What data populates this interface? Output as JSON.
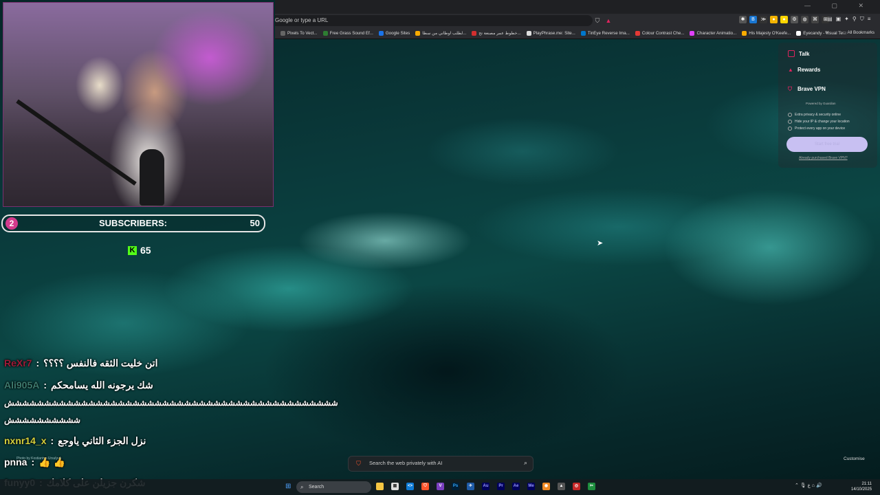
{
  "browser": {
    "url_placeholder": "Google or type a URL",
    "bookmarks": [
      {
        "label": "Pixels To Vect...",
        "color": "#666"
      },
      {
        "label": "Free Grass Sound Ef...",
        "color": "#2e7d32"
      },
      {
        "label": "Google Sites",
        "color": "#1a73e8"
      },
      {
        "label": "لطلب اوطاني من سطا...",
        "color": "#f9ab00"
      },
      {
        "label": "خطوط عمر مصنعة تح...",
        "color": "#d32f2f"
      },
      {
        "label": "PlayPhrase.me: Site...",
        "color": "#ddd"
      },
      {
        "label": "TinEye Reverse Ima...",
        "color": "#0077cc"
      },
      {
        "label": "Colour Contrast Che...",
        "color": "#e53935"
      },
      {
        "label": "Character Animatio...",
        "color": "#e040fb"
      },
      {
        "label": "His Majesty O'Keefe...",
        "color": "#f9ab00"
      },
      {
        "label": "Eyecandy - Visual Te...",
        "color": "#fff"
      }
    ],
    "all_bookmarks": "All Bookmarks"
  },
  "overlay": {
    "sub_count": "2",
    "sub_label": "SUBSCRIBERS:",
    "sub_goal": "50",
    "kick_viewers": "65"
  },
  "chat": [
    {
      "user": "ReXr7",
      "sep": ":",
      "msg": "اتن خليت الثقه فالنفس ؟؟؟؟",
      "user_color": "#9e1b38"
    },
    {
      "user": "Ali905A",
      "sep": ":",
      "msg": "شك يرجونه الله يسامحكم",
      "user_color": "#3d7a6e"
    },
    {
      "user": "",
      "sep": "",
      "msg": "ششششششششششششششششششششششششششششششششششششششششششششش",
      "user_color": "#fff"
    },
    {
      "user": "",
      "sep": "",
      "msg": "شششششششششش",
      "user_color": "#fff"
    },
    {
      "user": "nxnr14_x",
      "sep": ":",
      "msg": "نزل الجزء الثاني ياوجع",
      "user_color": "#d6d03c"
    },
    {
      "user": "pnna",
      "sep": ":",
      "msg": "👍 👍",
      "user_color": "#ffffff"
    },
    {
      "user": "funyy0",
      "sep": ":",
      "msg": "شكرن جزيلن على كلامك",
      "user_color": "#ffffff"
    }
  ],
  "panel": {
    "talk": "Talk",
    "rewards": "Rewards",
    "vpn": "Brave VPN",
    "powered": "Powered by Guardian",
    "features": [
      "Extra privacy & security online",
      "Hide your IP & change your location",
      "Protect every app on your device"
    ],
    "cta": "Start free trial",
    "purchased": "Already purchased Brave VPN?"
  },
  "newtab": {
    "search_placeholder": "Search the web privately with AI",
    "customise": "Customise",
    "photo_credit": "Photo by Kostiantyn Ursulyuk"
  },
  "taskbar": {
    "search_label": "Search",
    "time": "21:11",
    "date": "14/10/2025"
  }
}
